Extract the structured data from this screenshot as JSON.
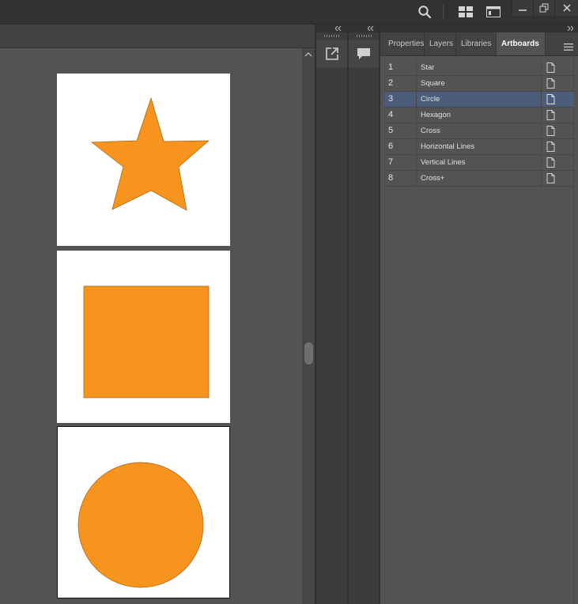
{
  "titlebar": {
    "icons": [
      "search-icon",
      "workspace-layout-icon",
      "panel-toggle-icon",
      "minimize-icon",
      "restore-icon",
      "close-icon"
    ]
  },
  "canvas": {
    "artboards": [
      {
        "name": "Star",
        "shape": "star",
        "fill": "#F7941D"
      },
      {
        "name": "Square",
        "shape": "square",
        "fill": "#F7941D"
      },
      {
        "name": "Circle",
        "shape": "circle",
        "fill": "#F7941D",
        "selected": true
      }
    ]
  },
  "dock": {
    "icons": [
      "export-icon",
      "comment-icon"
    ]
  },
  "panel": {
    "tabs": [
      {
        "label": "Properties",
        "active": false
      },
      {
        "label": "Layers",
        "active": false
      },
      {
        "label": "Libraries",
        "active": false
      },
      {
        "label": "Artboards",
        "active": true
      }
    ],
    "menu_icon": "hamburger-icon",
    "artboards": [
      {
        "num": "1",
        "name": "Star"
      },
      {
        "num": "2",
        "name": "Square"
      },
      {
        "num": "3",
        "name": "Circle",
        "selected": true
      },
      {
        "num": "4",
        "name": "Hexagon"
      },
      {
        "num": "5",
        "name": "Cross"
      },
      {
        "num": "6",
        "name": "Horizontal Lines"
      },
      {
        "num": "7",
        "name": "Vertical Lines"
      },
      {
        "num": "8",
        "name": "Cross+"
      }
    ]
  },
  "colors": {
    "accent_fill": "#F7941D",
    "selection": "#4B5D7B",
    "ui_dark": "#323232",
    "ui_mid": "#535353"
  }
}
